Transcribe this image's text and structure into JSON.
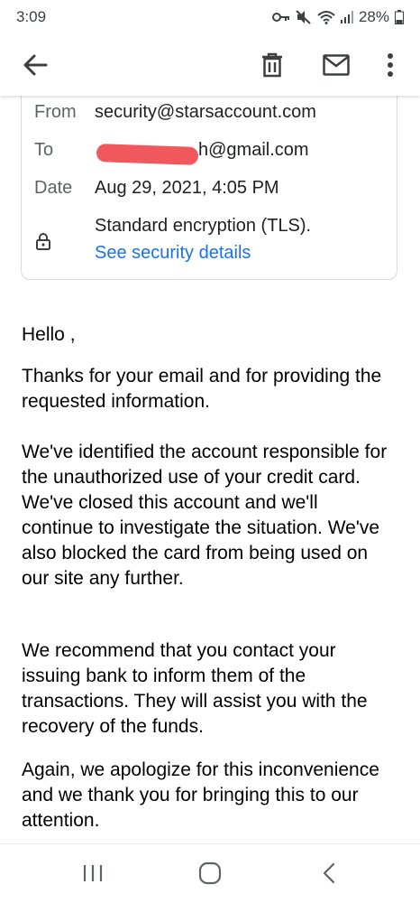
{
  "status_bar": {
    "time": "3:09",
    "battery": "28%",
    "icons": [
      "key-icon",
      "muted-icon",
      "wifi-icon",
      "signal-icon",
      "battery-icon"
    ]
  },
  "app_bar": {
    "icons": [
      "back-arrow-icon",
      "delete-icon",
      "mark-unread-icon",
      "more-vert-icon"
    ]
  },
  "details": {
    "from_label": "From",
    "from_value": "security@starsaccount.com",
    "to_label": "To",
    "to_value_visible": "h@gmail.com",
    "date_label": "Date",
    "date_value": "Aug 29, 2021, 4:05 PM",
    "encryption": "Standard encryption (TLS).",
    "security_link": "See security details"
  },
  "body": {
    "greeting": "Hello ,",
    "paragraphs": [
      "Thanks for your email and for providing the requested information.",
      "We've identified the account responsible for the unauthorized use of your credit card. We've closed this account and we'll continue to investigate the situation. We've also blocked the card from being used on our site any further.",
      "We recommend that you contact your issuing bank to inform them of the transactions. They will assist you with the recovery of the funds.",
      "Again, we apologize for this inconvenience and we thank you for bringing this to our attention."
    ]
  },
  "nav_bar": {
    "icons": [
      "recents-icon",
      "home-icon",
      "nav-back-icon"
    ]
  },
  "colors": {
    "link": "#1a73e8",
    "redaction": "#f0585e",
    "label": "#5f6368"
  }
}
